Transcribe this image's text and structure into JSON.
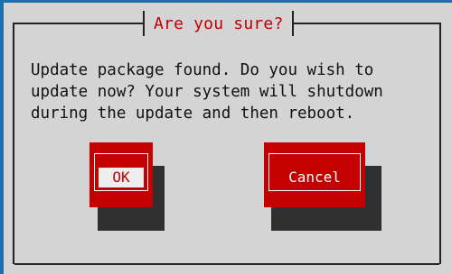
{
  "dialog": {
    "title": "Are you sure?",
    "message": "Update package found. Do you wish to\nupdate now? Your system will shutdown\nduring the update and then reboot.",
    "buttons": {
      "ok_label": "OK",
      "cancel_label": "Cancel"
    },
    "focused_button": "ok"
  },
  "colors": {
    "background": "#1f6fa8",
    "dialog_bg": "#d4d4d4",
    "title_text": "#c00000",
    "button_bg": "#c40000",
    "button_shadow": "#303030",
    "focused_label_bg": "#eeeeee"
  }
}
